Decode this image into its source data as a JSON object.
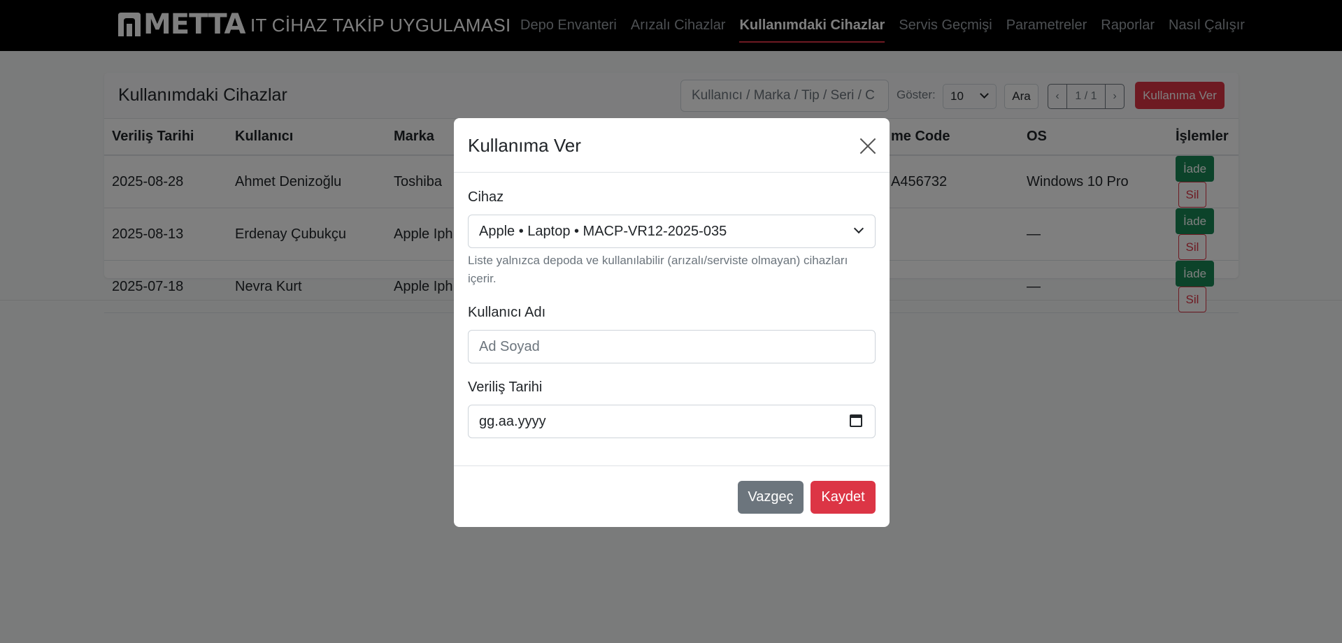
{
  "brand": {
    "logo_text": "METTA",
    "app_title": "IT CİHAZ TAKİP UYGULAMASI"
  },
  "nav": {
    "items": [
      {
        "label": "Depo Envanteri",
        "active": false
      },
      {
        "label": "Arızalı Cihazlar",
        "active": false
      },
      {
        "label": "Kullanımdaki Cihazlar",
        "active": true
      },
      {
        "label": "Servis Geçmişi",
        "active": false
      },
      {
        "label": "Parametreler",
        "active": false
      },
      {
        "label": "Raporlar",
        "active": false
      },
      {
        "label": "Nasıl Çalışır",
        "active": false
      }
    ]
  },
  "page": {
    "title": "Kullanımdaki Cihazlar",
    "search_placeholder": "Kullanıcı / Marka / Tip / Seri / C",
    "show_label": "Göster:",
    "page_size": "10",
    "search_button": "Ara",
    "pager": {
      "prev": "‹",
      "info": "1 / 1",
      "next": "›"
    },
    "give_button": "Kullanıma Ver"
  },
  "table": {
    "columns": [
      "Veriliş Tarihi",
      "Kullanıcı",
      "Marka",
      "me Code",
      "OS",
      "İşlemler"
    ],
    "rows": [
      {
        "date": "2025-08-28",
        "user": "Ahmet Denizoğlu",
        "brand": "Toshiba",
        "code": "A456732",
        "os": "Windows 10 Pro"
      },
      {
        "date": "2025-08-13",
        "user": "Erdenay Çubukçu",
        "brand": "Apple Iph",
        "code": "",
        "os": "—"
      },
      {
        "date": "2025-07-18",
        "user": "Nevra Kurt",
        "brand": "Apple Iph",
        "code": "",
        "os": "—"
      }
    ],
    "return_label": "İade",
    "delete_label": "Sil"
  },
  "modal": {
    "title": "Kullanıma Ver",
    "device_label": "Cihaz",
    "device_value": "Apple • Laptop • MACP-VR12-2025-035",
    "device_help": "Liste yalnızca depoda ve kullanılabilir (arızalı/serviste olmayan) cihazları içerir.",
    "user_label": "Kullanıcı Adı",
    "user_placeholder": "Ad Soyad",
    "date_label": "Veriliş Tarihi",
    "date_placeholder": "gg.aa.yyyy",
    "cancel_label": "Vazgeç",
    "save_label": "Kaydet"
  },
  "colors": {
    "accent": "#dc3545",
    "success": "#198754",
    "secondary": "#6c757d",
    "navbar": "#000000"
  },
  "icons": [
    "logo-icon",
    "chevron-down-icon",
    "close-icon",
    "calendar-icon"
  ]
}
